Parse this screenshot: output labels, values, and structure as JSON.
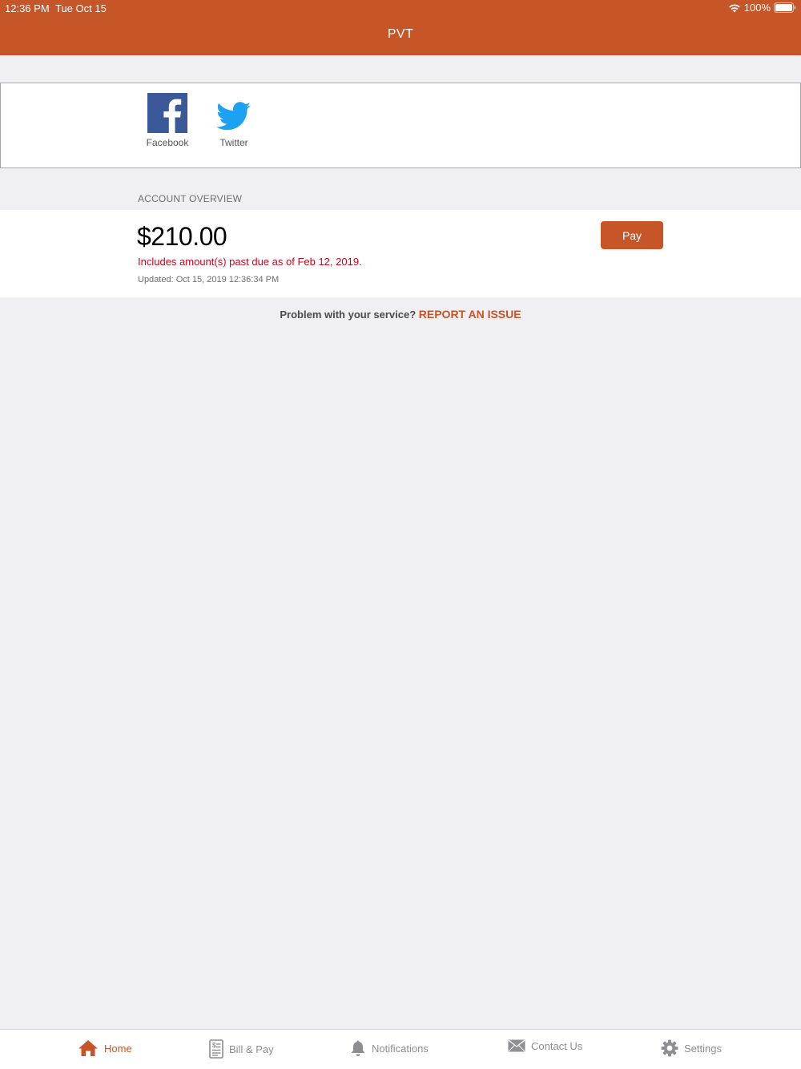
{
  "status_bar": {
    "time": "12:36 PM",
    "date": "Tue Oct 15",
    "battery": "100%"
  },
  "header": {
    "title": "PVT"
  },
  "social": {
    "facebook_label": "Facebook",
    "twitter_label": "Twitter"
  },
  "account": {
    "section_title": "ACCOUNT OVERVIEW",
    "amount": "$210.00",
    "past_due": "Includes amount(s) past due as of Feb 12, 2019.",
    "updated": "Updated: Oct 15, 2019 12:36:34 PM",
    "pay_label": "Pay"
  },
  "report": {
    "prompt": "Problem with your service? ",
    "link": "REPORT AN ISSUE"
  },
  "tabbar": {
    "items": [
      {
        "label": "Home",
        "icon": "home-icon",
        "active": true
      },
      {
        "label": "Bill & Pay",
        "icon": "bill-icon",
        "active": false
      },
      {
        "label": "Notifications",
        "icon": "bell-icon",
        "active": false
      },
      {
        "label": "Contact Us",
        "icon": "envelope-icon",
        "active": false
      },
      {
        "label": "Settings",
        "icon": "gear-icon",
        "active": false
      }
    ]
  },
  "colors": {
    "brand": "#c65628",
    "background": "#efeff4",
    "alert": "#d0021b",
    "facebook": "#3b5998",
    "twitter": "#1da1f2",
    "inactive": "#8e8e93"
  }
}
